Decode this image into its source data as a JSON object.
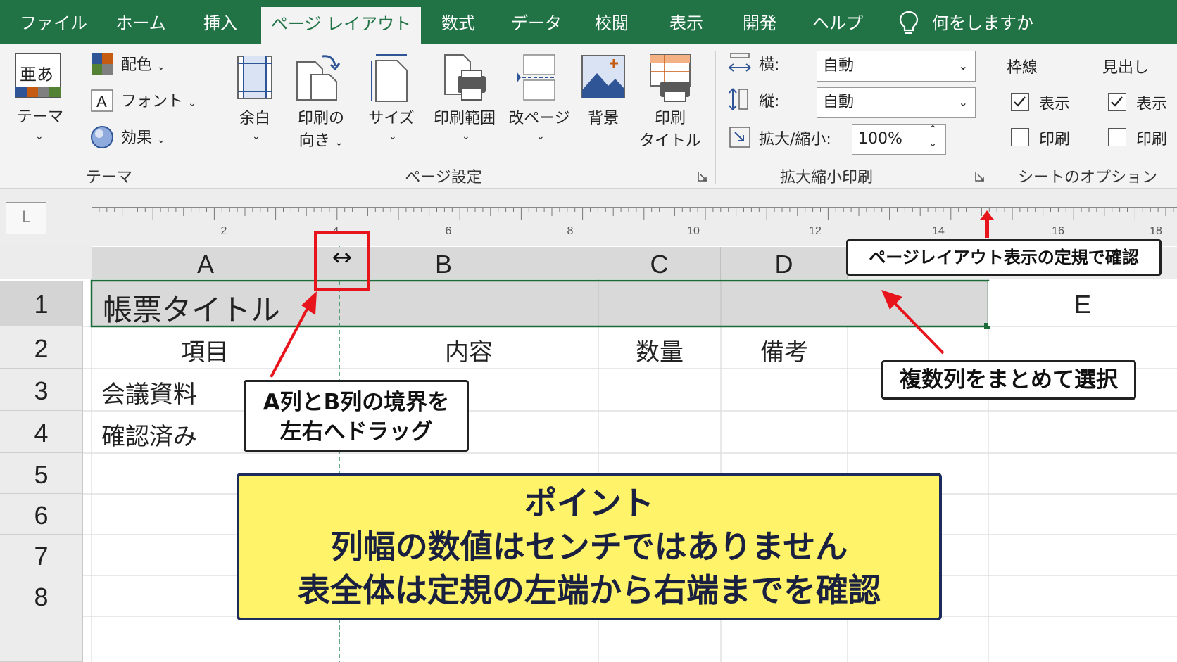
{
  "tabs": [
    {
      "label": "ファイル"
    },
    {
      "label": "ホーム"
    },
    {
      "label": "挿入"
    },
    {
      "label": "ページ レイアウト",
      "active": true
    },
    {
      "label": "数式"
    },
    {
      "label": "データ"
    },
    {
      "label": "校閲"
    },
    {
      "label": "表示"
    },
    {
      "label": "開発"
    },
    {
      "label": "ヘルプ"
    }
  ],
  "tell_me": "何をしますか",
  "ribbon": {
    "theme": {
      "themes_label": "テーマ",
      "themes_icon_text": "亜あ",
      "colors": "配色",
      "fonts": "フォント",
      "effects": "効果",
      "group_label": "テーマ"
    },
    "page_setup": {
      "margins": "余白",
      "orientation_1": "印刷の",
      "orientation_2": "向き",
      "size": "サイズ",
      "print_area": "印刷範囲",
      "breaks": "改ページ",
      "background": "背景",
      "print_titles_1": "印刷",
      "print_titles_2": "タイトル",
      "group_label": "ページ設定"
    },
    "scale": {
      "width_label": "横:",
      "width_value": "自動",
      "height_label": "縦:",
      "height_value": "自動",
      "scale_label": "拡大/縮小:",
      "scale_value": "100%",
      "group_label": "拡大縮小印刷"
    },
    "sheet_options": {
      "gridlines": "枠線",
      "headings": "見出し",
      "view": "表示",
      "print": "印刷",
      "gridlines_view_checked": true,
      "gridlines_print_checked": false,
      "headings_view_checked": true,
      "headings_print_checked": false,
      "group_label": "シートのオプション"
    }
  },
  "ruler": {
    "corner": "L",
    "numbers": [
      "2",
      "4",
      "6",
      "8",
      "10",
      "12",
      "14",
      "16",
      "18"
    ]
  },
  "columns": [
    "A",
    "B",
    "C",
    "D",
    "E"
  ],
  "rows": [
    "1",
    "2",
    "3",
    "4",
    "5",
    "6",
    "7",
    "8"
  ],
  "cells": {
    "A1": "帳票タイトル",
    "A2": "項目",
    "B2": "内容",
    "C2": "数量",
    "D2": "備考",
    "A3": "会議資料",
    "A4": "確認済み"
  },
  "callouts": {
    "ruler_note": "ページレイアウト表示の定規で確認",
    "multi_select": "複数列をまとめて選択",
    "drag_1": "A列とB列の境界を",
    "drag_2": "左右へドラッグ",
    "point_title": "ポイント",
    "point_line1": "列幅の数値はセンチではありません",
    "point_line2": "表全体は定規の左端から右端までを確認"
  },
  "resize_cursor": "↔",
  "colors": {
    "excel_green": "#217346",
    "callout_red": "#e8141b",
    "point_yellow": "#fff36a",
    "point_border": "#1d2a5c"
  }
}
